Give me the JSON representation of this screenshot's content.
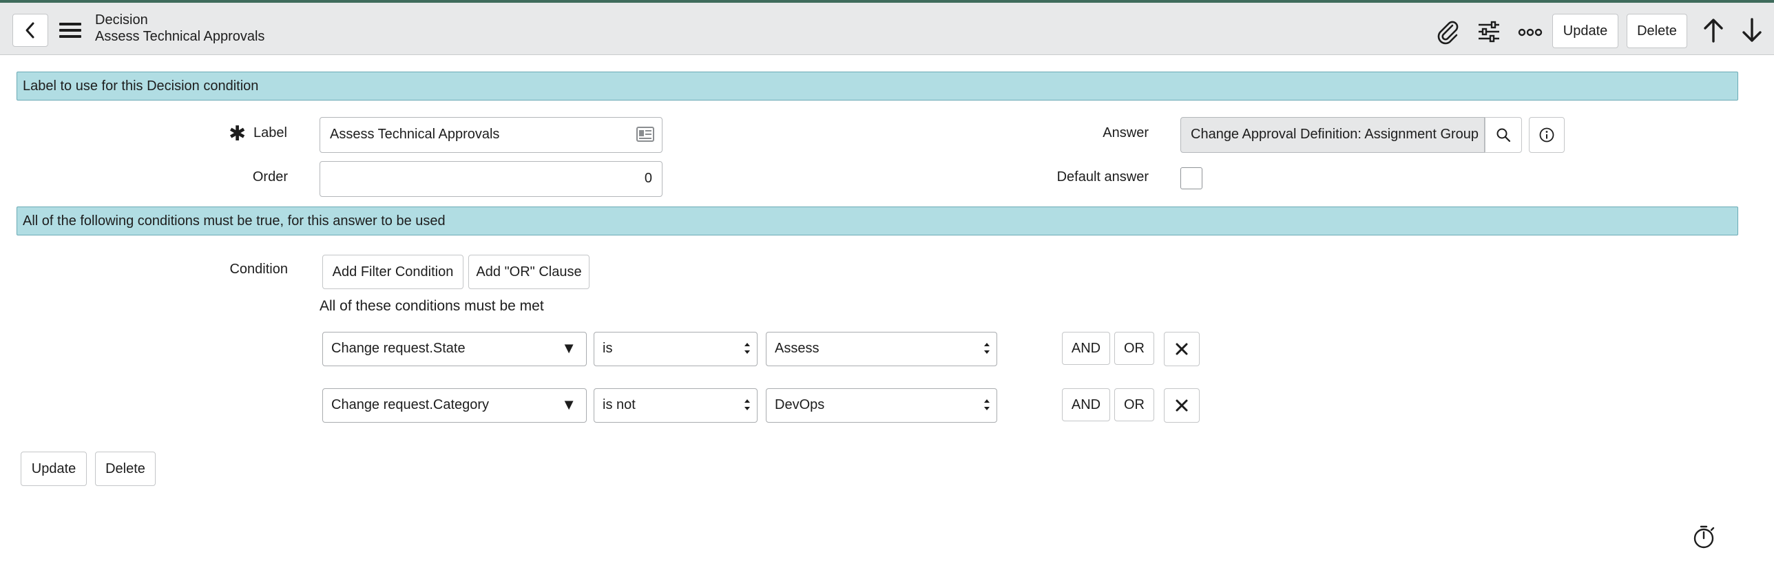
{
  "header": {
    "record_type": "Decision",
    "record_title": "Assess Technical Approvals",
    "update_label": "Update",
    "delete_label": "Delete",
    "icons": [
      "back-icon",
      "menu-icon",
      "attachment-icon",
      "personalize-icon",
      "more-icon",
      "arrow-up-icon",
      "arrow-down-icon"
    ]
  },
  "sections": {
    "label_section": "Label to use for this Decision condition",
    "conditions_section": "All of the following conditions must be true, for this answer to be used"
  },
  "form": {
    "required_mark": "✱",
    "label_label": "Label",
    "label_value": "Assess Technical Approvals",
    "order_label": "Order",
    "order_value": "0",
    "answer_label": "Answer",
    "answer_value": "Change Approval Definition: Assignment Group",
    "default_answer_label": "Default answer",
    "default_answer_checked": false
  },
  "condition": {
    "label": "Condition",
    "add_filter_label": "Add Filter Condition",
    "add_or_label": "Add \"OR\" Clause",
    "heading": "All of these conditions must be met",
    "and_label": "AND",
    "or_label": "OR",
    "rows": [
      {
        "field": "Change request.State",
        "operator": "is",
        "value": "Assess"
      },
      {
        "field": "Change request.Category",
        "operator": "is not",
        "value": "DevOps"
      }
    ]
  },
  "footer": {
    "update_label": "Update",
    "delete_label": "Delete"
  }
}
